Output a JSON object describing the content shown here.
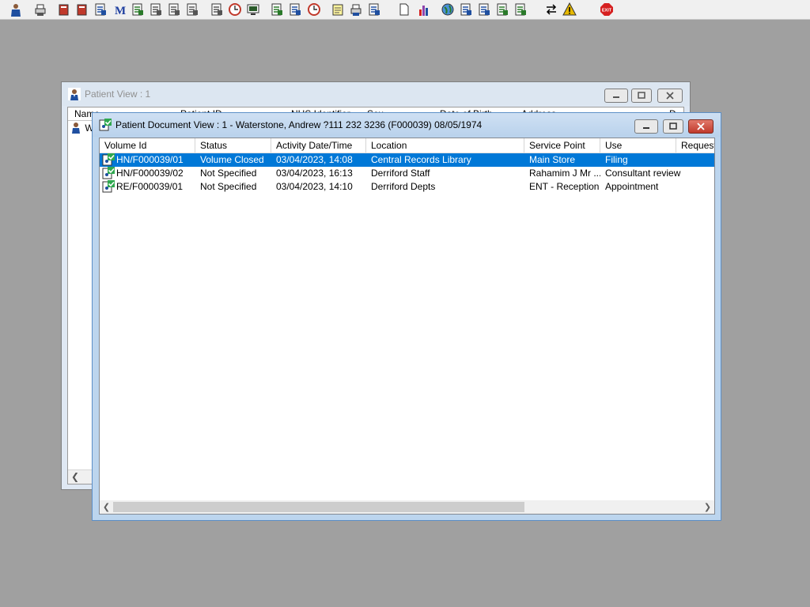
{
  "toolbar": {
    "buttons": [
      {
        "name": "patient-icon",
        "color": "#1f4fa0"
      },
      {
        "name": "printer-icon",
        "color": "#555555"
      },
      {
        "name": "book-icon",
        "color": "#c0392b"
      },
      {
        "name": "edit-book-icon",
        "color": "#c0392b"
      },
      {
        "name": "document-list-icon",
        "color": "#1f4fa0"
      },
      {
        "name": "m-icon",
        "color": "#1f3fa0"
      },
      {
        "name": "doctor-icon",
        "color": "#2a7a2a"
      },
      {
        "name": "notes-icon",
        "color": "#555555"
      },
      {
        "name": "camera-icon",
        "color": "#555555"
      },
      {
        "name": "flag-icon",
        "color": "#555555"
      },
      {
        "name": "search-document-icon",
        "color": "#555555"
      },
      {
        "name": "clock-icon",
        "color": "#c0392b"
      },
      {
        "name": "monitor-icon",
        "color": "#2a5a2a"
      },
      {
        "name": "report-chart-icon",
        "color": "#2a7a2a"
      },
      {
        "name": "message-icon",
        "color": "#1f4fa0"
      },
      {
        "name": "history-icon",
        "color": "#c0392b"
      },
      {
        "name": "note-pad-icon",
        "color": "#c8a000"
      },
      {
        "name": "printer-transfer-icon",
        "color": "#1f4fa0"
      },
      {
        "name": "transport-icon",
        "color": "#1f4fa0"
      },
      {
        "name": "blank-page-icon",
        "color": "#555555"
      },
      {
        "name": "bar-chart-icon",
        "color": "#8e44ad"
      },
      {
        "name": "globe-icon",
        "color": "#2a7a2a"
      },
      {
        "name": "checklist-icon",
        "color": "#1f4fa0"
      },
      {
        "name": "checklist-edit-icon",
        "color": "#1f4fa0"
      },
      {
        "name": "download-check-icon",
        "color": "#2a7a2a"
      },
      {
        "name": "refresh-check-icon",
        "color": "#2a7a2a"
      },
      {
        "name": "swap-arrows-icon",
        "color": "#000000"
      },
      {
        "name": "warning-icon",
        "color": "#e6b800"
      },
      {
        "name": "exit-icon",
        "color": "#d62020"
      }
    ],
    "exit_label": "EXIT"
  },
  "back_window": {
    "title": "Patient View : 1",
    "columns": [
      "Name",
      "Patient ID",
      "NHS Identifier",
      "Sex",
      "Date of Birth",
      "Address",
      "D"
    ],
    "row_prefix": "W"
  },
  "front_window": {
    "title": "Patient Document View : 1 - Waterstone, Andrew ?111 232 3236 (F000039) 08/05/1974",
    "columns": [
      "Volume Id",
      "Status",
      "Activity Date/Time",
      "Location",
      "Service Point",
      "Use",
      "Requeste"
    ],
    "rows": [
      {
        "volume_id": "HN/F000039/01",
        "status": "Volume Closed",
        "activity": "03/04/2023, 14:08",
        "location": "Central Records Library",
        "service_point": "Main Store",
        "use": "Filing",
        "selected": true
      },
      {
        "volume_id": "HN/F000039/02",
        "status": "Not Specified",
        "activity": "03/04/2023, 16:13",
        "location": "Derriford Staff",
        "service_point": "Rahamim J Mr ...",
        "use": "Consultant review",
        "selected": false
      },
      {
        "volume_id": "RE/F000039/01",
        "status": "Not Specified",
        "activity": "03/04/2023, 14:10",
        "location": "Derriford Depts",
        "service_point": "ENT - Reception",
        "use": "Appointment",
        "selected": false
      }
    ]
  },
  "colors": {
    "desktop": "#a0a0a0",
    "selection": "#0078d7",
    "active_frame": "#bcd5ee",
    "inactive_frame": "#dfe8f3"
  }
}
